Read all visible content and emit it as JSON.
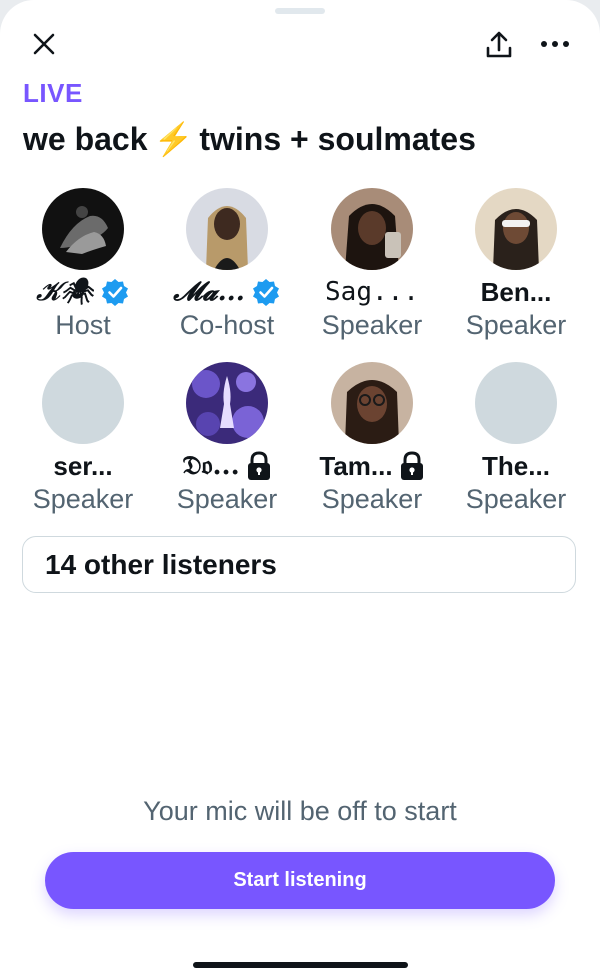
{
  "header": {
    "close_icon": "close-icon",
    "share_icon": "share-icon",
    "more_icon": "more-icon"
  },
  "space": {
    "status": "LIVE",
    "title_part1": "we back",
    "title_emoji": "⚡",
    "title_part2": "twins + soulmates"
  },
  "participants": [
    {
      "name": "𝒦🕷",
      "role": "Host",
      "verified": true,
      "locked": false,
      "avatar": "photo"
    },
    {
      "name": "𝓜𝓪...",
      "role": "Co-host",
      "verified": true,
      "locked": false,
      "avatar": "photo"
    },
    {
      "name": "Sag...",
      "role": "Speaker",
      "verified": false,
      "locked": false,
      "avatar": "photo"
    },
    {
      "name": "Ben...",
      "role": "Speaker",
      "verified": false,
      "locked": false,
      "avatar": "photo"
    },
    {
      "name": "ser...",
      "role": "Speaker",
      "verified": false,
      "locked": false,
      "avatar": "placeholder"
    },
    {
      "name": "𝔇𝔬...",
      "role": "Speaker",
      "verified": false,
      "locked": true,
      "avatar": "photo"
    },
    {
      "name": "Tam...",
      "role": "Speaker",
      "verified": false,
      "locked": true,
      "avatar": "photo"
    },
    {
      "name": "The...",
      "role": "Speaker",
      "verified": false,
      "locked": false,
      "avatar": "placeholder"
    }
  ],
  "listeners": {
    "label": "14 other listeners"
  },
  "footer": {
    "mic_note": "Your mic will be off to start",
    "start_button": "Start listening"
  },
  "colors": {
    "accent": "#7856ff",
    "verified": "#1d9bf0",
    "text_primary": "#0f1419",
    "text_secondary": "#536471",
    "placeholder_avatar": "#cfd9de"
  }
}
